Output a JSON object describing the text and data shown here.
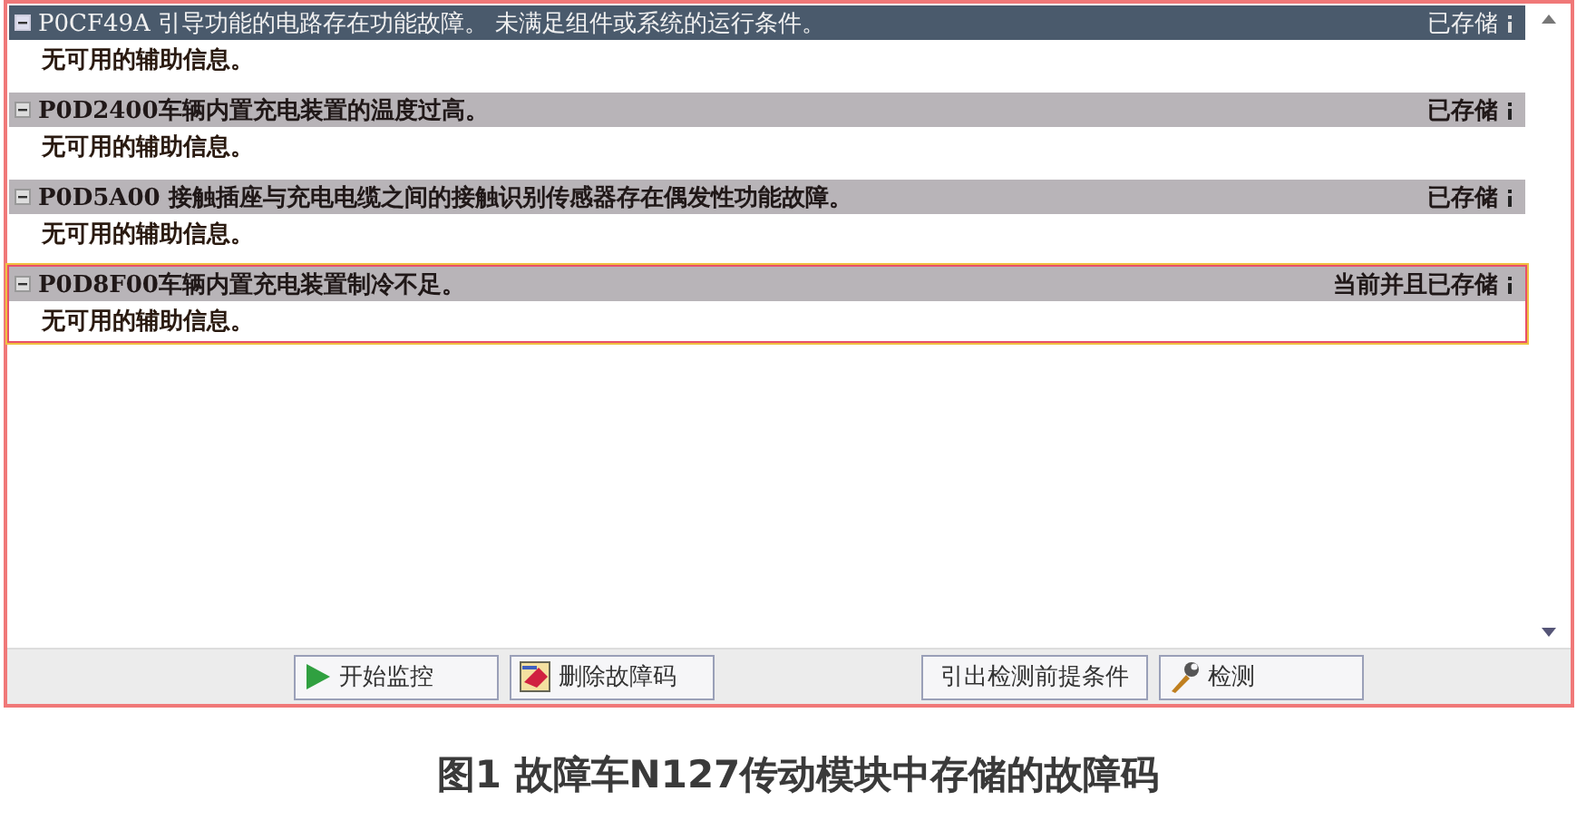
{
  "faults": [
    {
      "code_text": "P0CF49A 引导功能的电路存在功能故障。 未满足组件或系统的运行条件。",
      "status": "已存储",
      "selected": true,
      "outlined": false,
      "expanded": true,
      "detail": "无可用的辅助信息。"
    },
    {
      "code_text": "P0D2400车辆内置充电装置的温度过高。",
      "status": "已存储",
      "selected": false,
      "outlined": false,
      "expanded": true,
      "detail": "无可用的辅助信息。"
    },
    {
      "code_text": "P0D5A00 接触插座与充电电缆之间的接触识别传感器存在偶发性功能故障。",
      "status": "已存储",
      "selected": false,
      "outlined": false,
      "expanded": true,
      "detail": "无可用的辅助信息。"
    },
    {
      "code_text": "P0D8F00车辆内置充电装置制冷不足。",
      "status": "当前并且已存储",
      "selected": false,
      "outlined": true,
      "expanded": true,
      "detail": "无可用的辅助信息。"
    }
  ],
  "buttons": [
    {
      "label": "开始监控"
    },
    {
      "label": "删除故障码"
    },
    {
      "label": "引出检测前提条件"
    },
    {
      "label": "检测"
    }
  ],
  "caption": "图1 故障车N127传动模块中存储的故障码"
}
